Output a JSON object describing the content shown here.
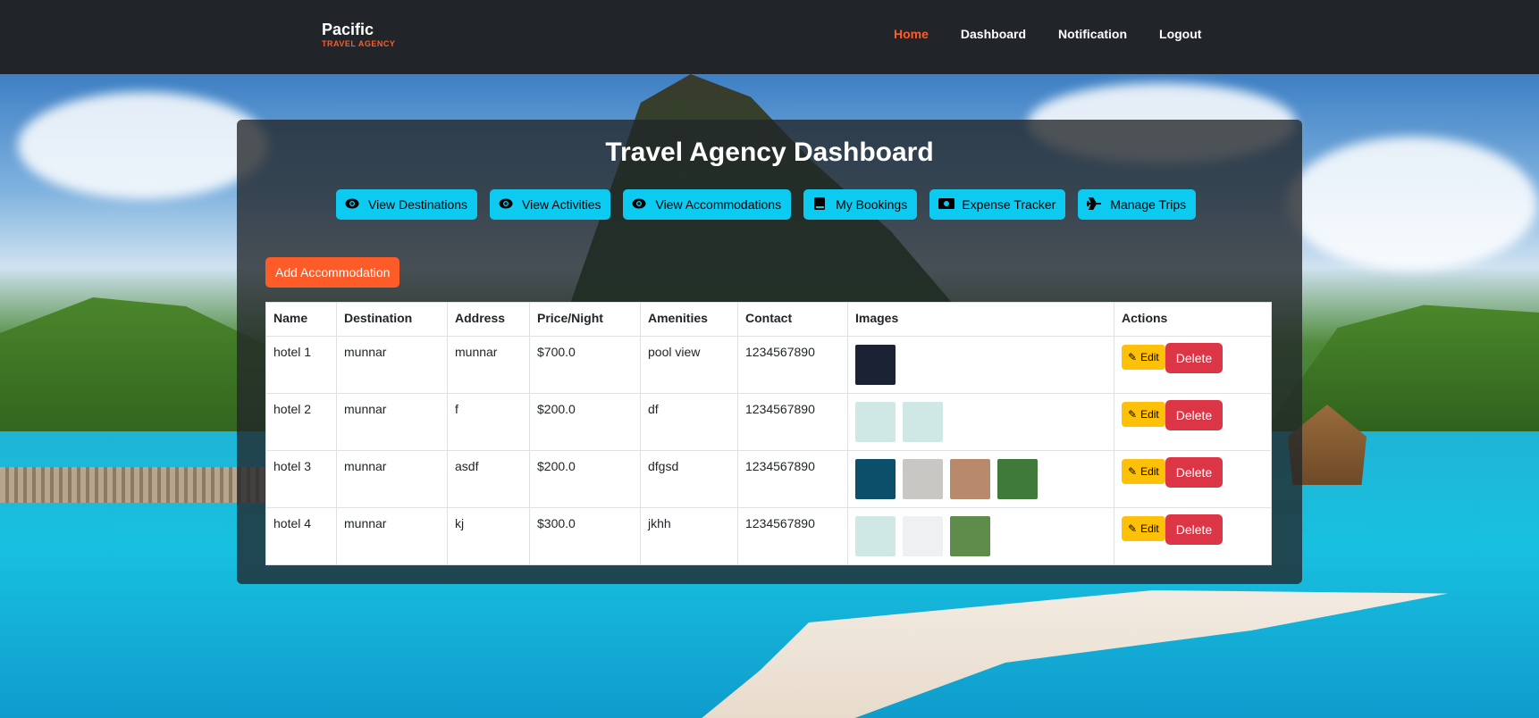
{
  "brand": {
    "name": "Pacific",
    "tagline": "TRAVEL AGENCY"
  },
  "nav": [
    {
      "label": "Home",
      "active": true
    },
    {
      "label": "Dashboard",
      "active": false
    },
    {
      "label": "Notification",
      "active": false
    },
    {
      "label": "Logout",
      "active": false
    }
  ],
  "title": "Travel Agency Dashboard",
  "quick_actions": [
    {
      "label": "View Destinations",
      "icon": "eye-icon"
    },
    {
      "label": "View Activities",
      "icon": "eye-icon"
    },
    {
      "label": "View Accommodations",
      "icon": "eye-icon"
    },
    {
      "label": "My Bookings",
      "icon": "book-icon"
    },
    {
      "label": "Expense Tracker",
      "icon": "money-bill-icon"
    },
    {
      "label": "Manage Trips",
      "icon": "plane-icon"
    }
  ],
  "add_button": "Add Accommodation",
  "table": {
    "headers": [
      "Name",
      "Destination",
      "Address",
      "Price/Night",
      "Amenities",
      "Contact",
      "Images",
      "Actions"
    ],
    "rows": [
      {
        "name": "hotel 1",
        "destination": "munnar",
        "address": "munnar",
        "price": "$700.0",
        "amenities": "pool view",
        "contact": "1234567890",
        "images": [
          "#1b2233"
        ],
        "edit": "Edit",
        "delete": "Delete"
      },
      {
        "name": "hotel 2",
        "destination": "munnar",
        "address": "f",
        "price": "$200.0",
        "amenities": "df",
        "contact": "1234567890",
        "images": [
          "#cfe8e6",
          "#cfe8e6"
        ],
        "edit": "Edit",
        "delete": "Delete"
      },
      {
        "name": "hotel 3",
        "destination": "munnar",
        "address": "asdf",
        "price": "$200.0",
        "amenities": "dfgsd",
        "contact": "1234567890",
        "images": [
          "#0c4f6b",
          "#c9c7c4",
          "#b88a6b",
          "#3f7a3a"
        ],
        "edit": "Edit",
        "delete": "Delete"
      },
      {
        "name": "hotel 4",
        "destination": "munnar",
        "address": "kj",
        "price": "$300.0",
        "amenities": "jkhh",
        "contact": "1234567890",
        "images": [
          "#cfe8e6",
          "#eef0f2",
          "#5d8c4b"
        ],
        "edit": "Edit",
        "delete": "Delete"
      }
    ]
  },
  "colors": {
    "accent": "#fd5c28",
    "info": "#0dcaf0",
    "warning": "#ffc107",
    "danger": "#dc3545",
    "navbar": "#212529"
  }
}
